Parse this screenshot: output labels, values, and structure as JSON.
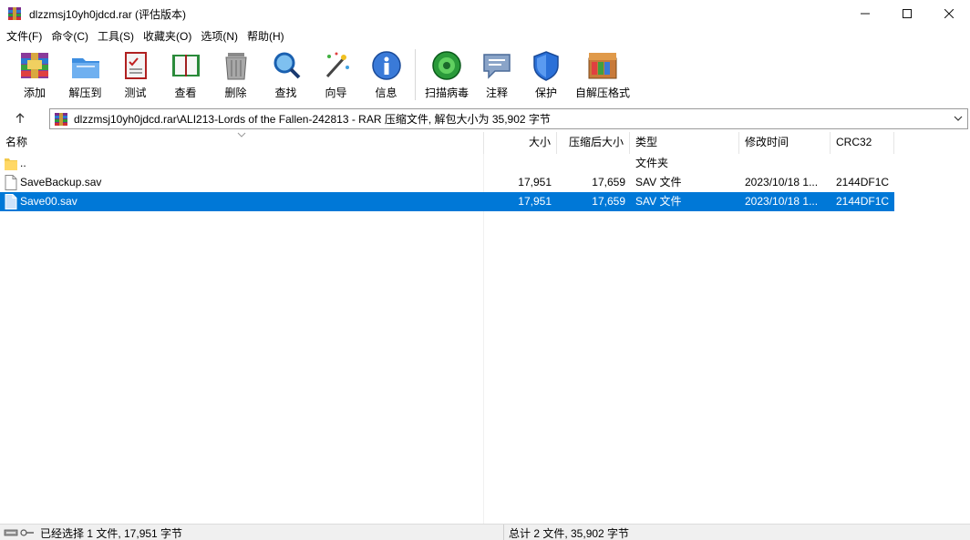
{
  "window": {
    "title": "dlzzmsj10yh0jdcd.rar (评估版本)",
    "minimize": "—",
    "maximize": "☐",
    "close": "✕"
  },
  "menu": {
    "items": [
      "文件(F)",
      "命令(C)",
      "工具(S)",
      "收藏夹(O)",
      "选项(N)",
      "帮助(H)"
    ]
  },
  "toolbar": {
    "tools": [
      {
        "label": "添加",
        "icon": "add-archive-icon"
      },
      {
        "label": "解压到",
        "icon": "extract-to-icon"
      },
      {
        "label": "测试",
        "icon": "test-icon"
      },
      {
        "label": "查看",
        "icon": "view-icon"
      },
      {
        "label": "删除",
        "icon": "delete-icon"
      },
      {
        "label": "查找",
        "icon": "find-icon"
      },
      {
        "label": "向导",
        "icon": "wizard-icon"
      },
      {
        "label": "信息",
        "icon": "info-icon"
      },
      {
        "label": "扫描病毒",
        "icon": "virus-scan-icon"
      },
      {
        "label": "注释",
        "icon": "comment-icon"
      },
      {
        "label": "保护",
        "icon": "protect-icon"
      },
      {
        "label": "自解压格式",
        "icon": "sfx-icon"
      }
    ]
  },
  "address": {
    "path": "dlzzmsj10yh0jdcd.rar\\ALI213-Lords of the Fallen-242813 - RAR 压缩文件, 解包大小为 35,902 字节"
  },
  "columns": {
    "name": "名称",
    "size": "大小",
    "packed": "压缩后大小",
    "type": "类型",
    "modified": "修改时间",
    "crc": "CRC32"
  },
  "files": [
    {
      "name": "..",
      "size": "",
      "packed": "",
      "type": "文件夹",
      "modified": "",
      "crc": "",
      "kind": "folder",
      "selected": false
    },
    {
      "name": "SaveBackup.sav",
      "size": "17,951",
      "packed": "17,659",
      "type": "SAV 文件",
      "modified": "2023/10/18 1...",
      "crc": "2144DF1C",
      "kind": "file",
      "selected": false
    },
    {
      "name": "Save00.sav",
      "size": "17,951",
      "packed": "17,659",
      "type": "SAV 文件",
      "modified": "2023/10/18 1...",
      "crc": "2144DF1C",
      "kind": "file",
      "selected": true
    }
  ],
  "status": {
    "left": "已经选择 1 文件, 17,951 字节",
    "right": "总计 2 文件, 35,902 字节"
  },
  "colors": {
    "selection": "#0078d7",
    "accent": "#1e6fd9"
  }
}
